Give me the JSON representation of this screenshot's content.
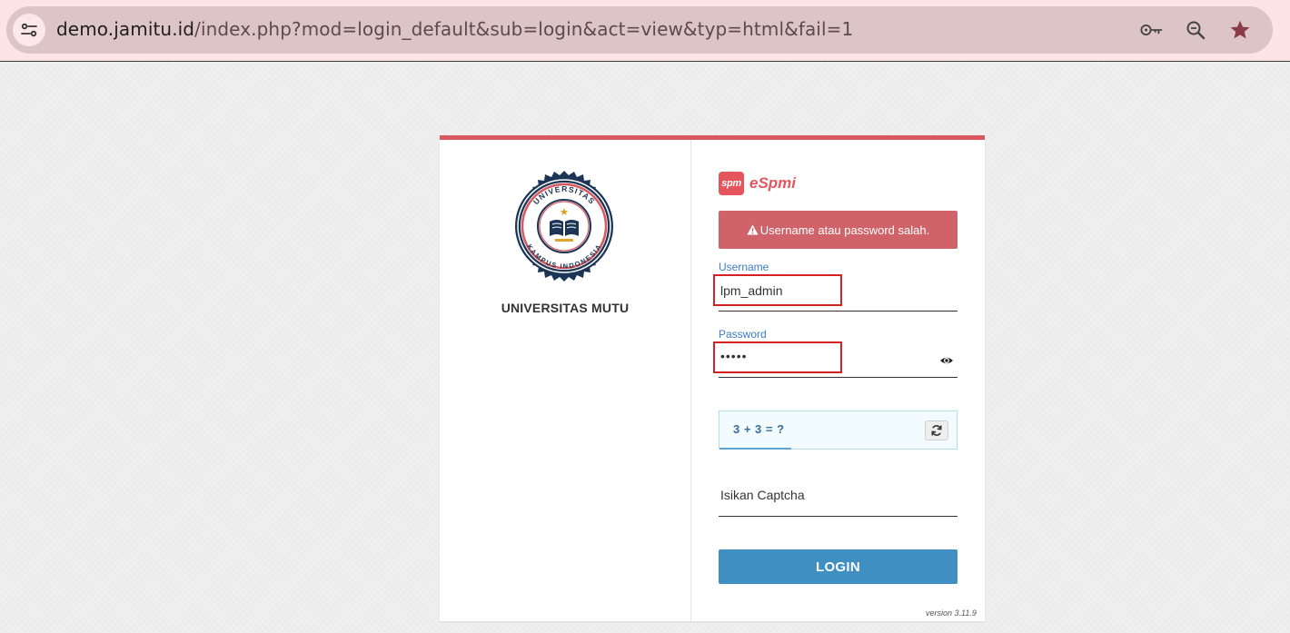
{
  "browser": {
    "url_domain": "demo.jamitu.id",
    "url_path": "/index.php?mod=login_default&sub=login&act=view&typ=html&fail=1",
    "icons": [
      "site-settings-icon",
      "key-icon",
      "zoom-icon",
      "star-icon"
    ],
    "bar_color": "#fde4e6"
  },
  "institution": {
    "name": "UNIVERSITAS MUTU",
    "seal_top_text": "UNIVERSITAS",
    "seal_bottom_text": "KAMPUS INDONESIA"
  },
  "brand": {
    "badge": "spm",
    "name": "eSpmi",
    "color": "#e4555e"
  },
  "alert": {
    "icon": "warning-icon",
    "message": "Username atau password salah."
  },
  "form": {
    "username_label": "Username",
    "username_value": "lpm_admin",
    "password_label": "Password",
    "password_value": "•••••",
    "captcha_question": "3 + 3 = ?",
    "captcha_placeholder": "Isikan Captcha",
    "login_label": "LOGIN"
  },
  "footer": {
    "version": "version 3.11.9"
  }
}
